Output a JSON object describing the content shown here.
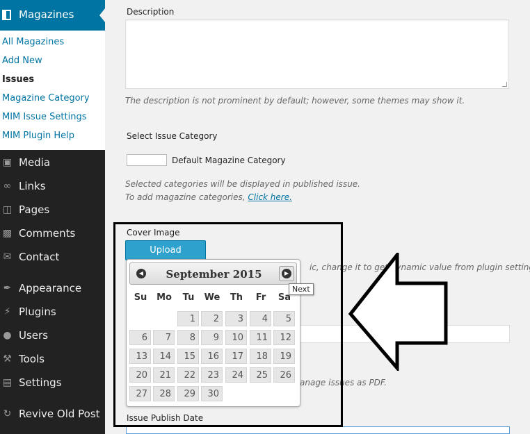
{
  "sidebar": {
    "active_menu": "Magazines",
    "submenu": [
      "All Magazines",
      "Add New",
      "Issues",
      "Magazine Category",
      "MIM Issue Settings",
      "MIM Plugin Help"
    ],
    "current_submenu": "Issues",
    "items": [
      {
        "label": "Media",
        "icon": "media-icon"
      },
      {
        "label": "Links",
        "icon": "links-icon"
      },
      {
        "label": "Pages",
        "icon": "pages-icon"
      },
      {
        "label": "Comments",
        "icon": "comments-icon"
      },
      {
        "label": "Contact",
        "icon": "mail-icon"
      },
      {
        "label": "Appearance",
        "icon": "appearance-icon"
      },
      {
        "label": "Plugins",
        "icon": "plugins-icon"
      },
      {
        "label": "Users",
        "icon": "users-icon"
      },
      {
        "label": "Tools",
        "icon": "tools-icon"
      },
      {
        "label": "Settings",
        "icon": "settings-icon"
      },
      {
        "label": "Revive Old Post",
        "icon": "revive-icon"
      }
    ]
  },
  "form": {
    "description_label": "Description",
    "description_value": "",
    "description_hint": "The description is not prominent by default; however, some themes may show it.",
    "category_label": "Select  Issue Category",
    "default_category": "Default Magazine Category",
    "category_hint_1": "Selected categories will be displayed in published issue.",
    "category_hint_2": "To add magazine categories, ",
    "category_link": "Click here.",
    "cover_label": "Cover Image",
    "upload_button": "Upload",
    "partial_hint_1": "ic, change it to get dynamic value from plugin settings.",
    "partial_hint_2": "anage issues as PDF.",
    "publish_date_label": "Issue Publish Date"
  },
  "datepicker": {
    "month_title": "September 2015",
    "prev_icon": "prev-arrow-icon",
    "next_icon": "next-arrow-icon",
    "next_tooltip": "Next",
    "weekdays": [
      "Su",
      "Mo",
      "Tu",
      "We",
      "Th",
      "Fr",
      "Sa"
    ],
    "weeks": [
      [
        "",
        "",
        "1",
        "2",
        "3",
        "4",
        "5"
      ],
      [
        "6",
        "7",
        "8",
        "9",
        "10",
        "11",
        "12"
      ],
      [
        "13",
        "14",
        "15",
        "16",
        "17",
        "18",
        "19"
      ],
      [
        "20",
        "21",
        "22",
        "23",
        "24",
        "25",
        "26"
      ],
      [
        "27",
        "28",
        "29",
        "30",
        "",
        "",
        ""
      ]
    ]
  },
  "annotation": {
    "highlight_color": "#000000",
    "arrow_color": "#000000"
  }
}
